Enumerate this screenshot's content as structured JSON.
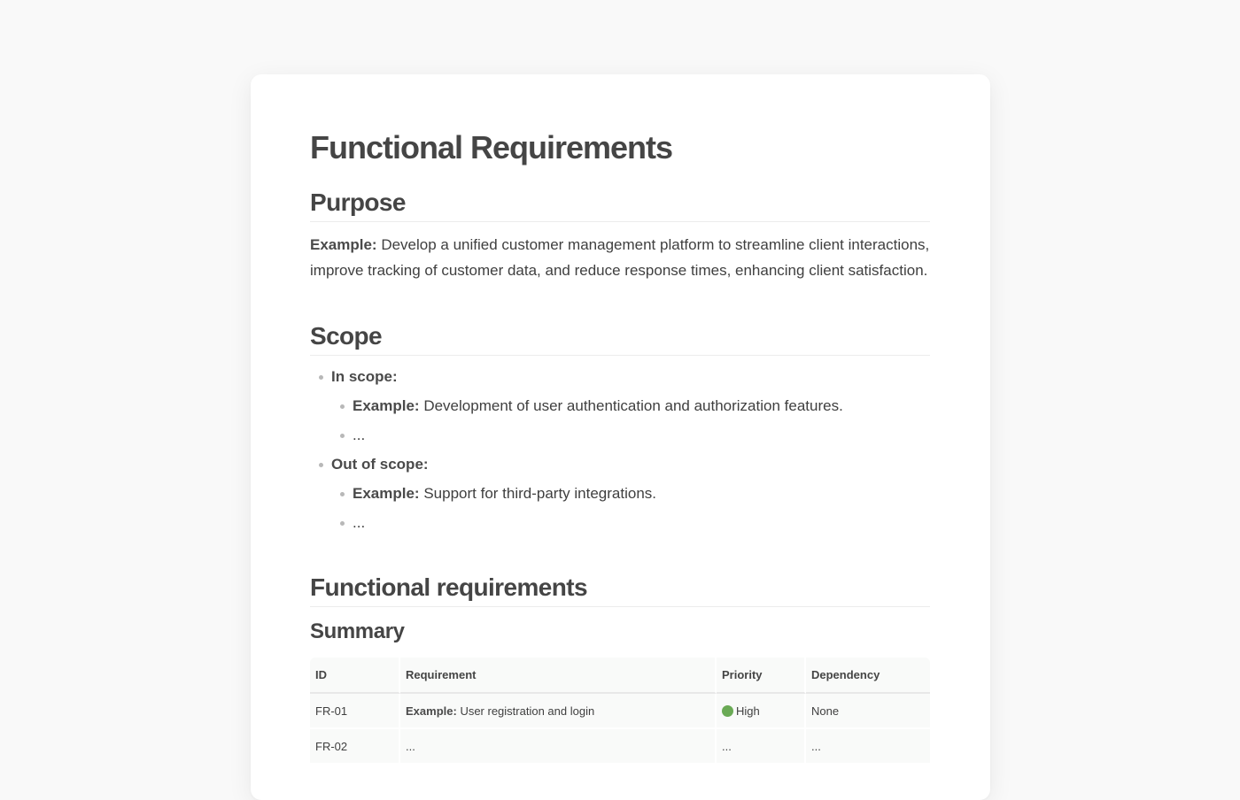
{
  "doc": {
    "title": "Functional Requirements",
    "purpose": {
      "heading": "Purpose",
      "example_label": "Example:",
      "text": "Develop a unified customer management platform to streamline client interactions, improve tracking of customer data, and reduce response times, enhancing client satisfaction."
    },
    "scope": {
      "heading": "Scope",
      "in_scope": {
        "label": "In scope:",
        "items": [
          {
            "label": "Example:",
            "text": "Development of user authentication and authorization features."
          },
          {
            "label": "",
            "text": "..."
          }
        ]
      },
      "out_scope": {
        "label": "Out of scope:",
        "items": [
          {
            "label": "Example:",
            "text": "Support for third-party integrations."
          },
          {
            "label": "",
            "text": "..."
          }
        ]
      }
    },
    "functional": {
      "heading": "Functional requirements",
      "summary_heading": "Summary",
      "table": {
        "headers": [
          "ID",
          "Requirement",
          "Priority",
          "Dependency"
        ],
        "rows": [
          {
            "id": "FR-01",
            "req_label": "Example:",
            "req_text": "User registration and login",
            "priority": "High",
            "priority_color": "#6aaa55",
            "dependency": "None"
          },
          {
            "id": "FR-02",
            "req_label": "",
            "req_text": "...",
            "priority": "...",
            "dependency": "..."
          }
        ]
      }
    }
  }
}
